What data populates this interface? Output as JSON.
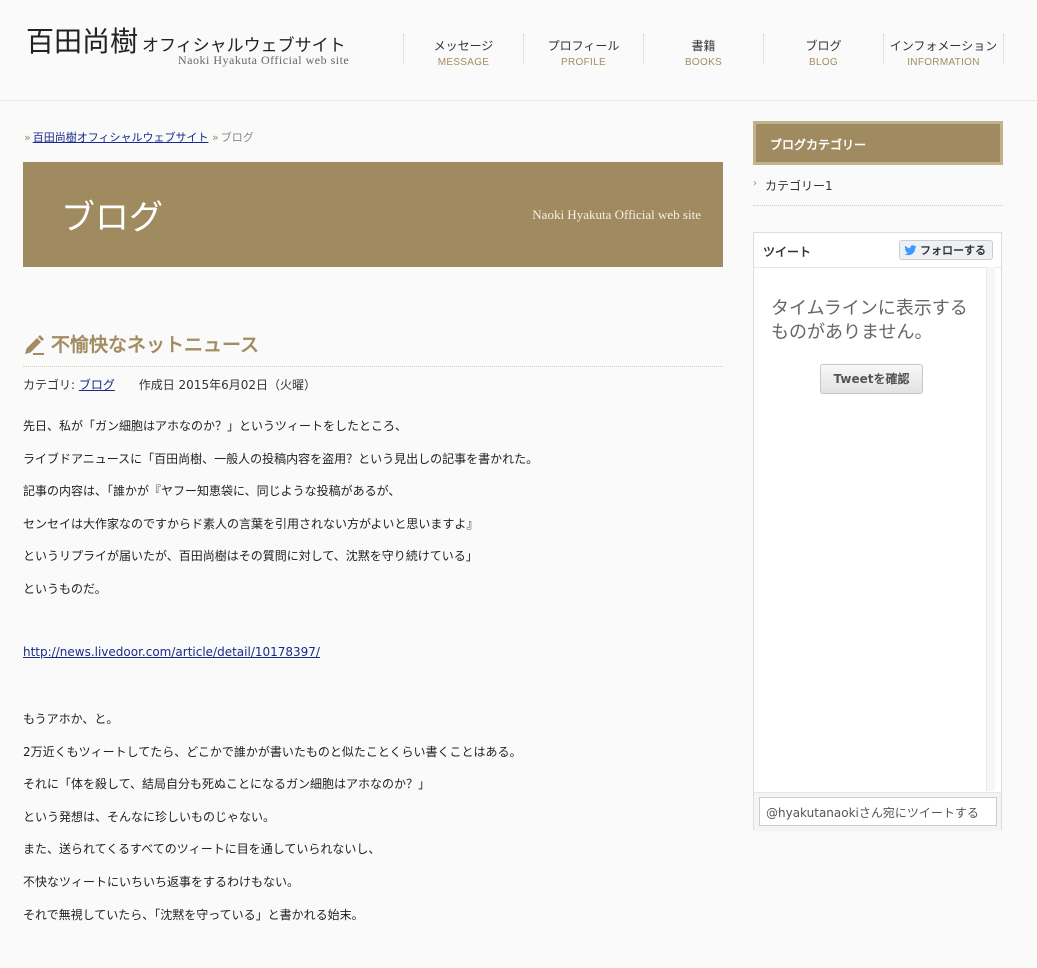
{
  "header": {
    "logo_jp": "百田尚樹",
    "logo_sub": "オフィシャルウェブサイト",
    "logo_en": "Naoki Hyakuta Official web site",
    "nav": [
      {
        "jp": "メッセージ",
        "en": "MESSAGE"
      },
      {
        "jp": "プロフィール",
        "en": "PROFILE"
      },
      {
        "jp": "書籍",
        "en": "BOOKS"
      },
      {
        "jp": "ブログ",
        "en": "BLOG"
      },
      {
        "jp": "インフォメーション",
        "en": "INFORMATION"
      }
    ]
  },
  "breadcrumb": {
    "home": "百田尚樹オフィシャルウェブサイト",
    "current": "ブログ"
  },
  "banner": {
    "title": "ブログ",
    "subtitle": "Naoki Hyakuta Official web site"
  },
  "article": {
    "title": "不愉快なネットニュース",
    "category_label": "カテゴリ:",
    "category_link": "ブログ",
    "date": "作成日 2015年6月02日（火曜）",
    "lines": [
      "先日、私が「ガン細胞はアホなのか？」というツィートをしたところ、",
      "ライブドアニュースに「百田尚樹、一般人の投稿内容を盗用？という見出しの記事を書かれた。",
      "記事の内容は、「誰かが『ヤフー知恵袋に、同じような投稿があるが、",
      "センセイは大作家なのですからド素人の言葉を引用されない方がよいと思いますよ』",
      "というリプライが届いたが、百田尚樹はその質問に対して、沈黙を守り続けている」",
      "というものだ。"
    ],
    "link": "http://news.livedoor.com/article/detail/10178397/",
    "lines2": [
      "もうアホか、と。",
      "2万近くもツィートしてたら、どこかで誰かが書いたものと似たことくらい書くことはある。",
      "それに「体を殺して、結局自分も死ぬことになるガン細胞はアホなのか？」",
      "という発想は、そんなに珍しいものじゃない。",
      "また、送られてくるすべてのツィートに目を通していられないし、",
      "不快なツィートにいちいち返事をするわけもない。",
      "それで無視していたら、「沈黙を守っている」と書かれる始末。"
    ]
  },
  "sidebar": {
    "category_heading": "ブログカテゴリー",
    "categories": [
      "カテゴリー1"
    ],
    "twitter": {
      "title": "ツイート",
      "follow": "フォローする",
      "empty": "タイムラインに表示するものがありません。",
      "check": "Tweetを確認",
      "input": "@hyakutanaokiさん宛にツイートする"
    }
  },
  "colors": {
    "accent": "#a08b61",
    "link": "#1a2a8a"
  }
}
